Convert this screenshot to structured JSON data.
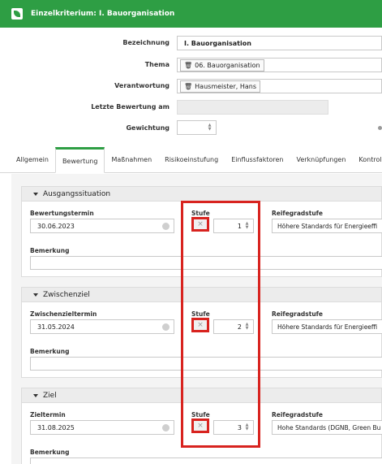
{
  "header": {
    "title": "Einzelkriterium: I. Bauorganisation"
  },
  "form": {
    "bezeichnung_label": "Bezeichnung",
    "bezeichnung_value": "I. Bauorganisation",
    "thema_label": "Thema",
    "thema_value": "06. Bauorganisation",
    "verantwortung_label": "Verantwortung",
    "verantwortung_value": "Hausmeister, Hans",
    "letzte_bewertung_label": "Letzte Bewertung am",
    "letzte_bewertung_value": "",
    "gewichtung_label": "Gewichtung",
    "gewichtung_value": ""
  },
  "tabs": [
    "Allgemein",
    "Bewertung",
    "Maßnahmen",
    "Risikoeinstufung",
    "Einflussfaktoren",
    "Verknüpfungen",
    "Kontrolle"
  ],
  "active_tab": "Bewertung",
  "sections": {
    "ausgangssituation": {
      "title": "Ausgangssituation",
      "date_label": "Bewertungstermin",
      "date_value": "30.06.2023",
      "stufe_label": "Stufe",
      "stufe_value": "1",
      "reifegrad_label": "Reifegradstufe",
      "reifegrad_value": "Höhere Standards für Energieeffi",
      "bemerkung_label": "Bemerkung"
    },
    "zwischenziel": {
      "title": "Zwischenziel",
      "date_label": "Zwischenzieltermin",
      "date_value": "31.05.2024",
      "stufe_label": "Stufe",
      "stufe_value": "2",
      "reifegrad_label": "Reifegradstufe",
      "reifegrad_value": "Höhere Standards für Energieeffi",
      "bemerkung_label": "Bemerkung"
    },
    "ziel": {
      "title": "Ziel",
      "date_label": "Zieltermin",
      "date_value": "31.08.2025",
      "stufe_label": "Stufe",
      "stufe_value": "3",
      "reifegrad_label": "Reifegradstufe",
      "reifegrad_value": "Hohe Standards (DGNB, Green Bu",
      "bemerkung_label": "Bemerkung"
    }
  },
  "icons": {
    "clear": "×"
  },
  "colors": {
    "brand_green": "#2e9e44",
    "highlight_red": "#d8231f"
  }
}
